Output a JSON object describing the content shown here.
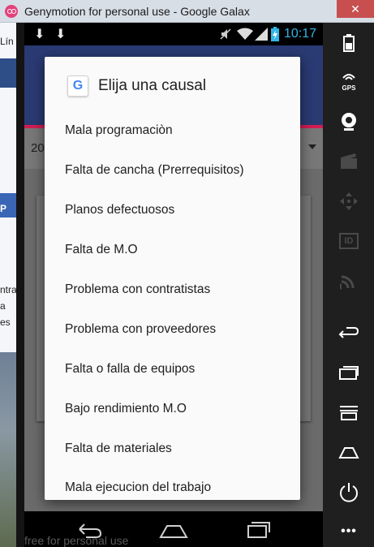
{
  "window": {
    "title": "Genymotion for personal use - Google Galax",
    "close_glyph": "✕"
  },
  "desktop": {
    "lines": [
      "Lín",
      "P",
      "ntra",
      "a",
      "es"
    ]
  },
  "statusbar": {
    "time": "10:17"
  },
  "app": {
    "spinner_value": "20"
  },
  "dialog": {
    "title": "Elija una causal",
    "logo_letter": "G",
    "items": [
      "Mala programaciòn",
      "Falta de cancha (Prerrequisitos)",
      "Planos defectuosos",
      "Falta de M.O",
      "Problema con contratistas",
      "Problema con proveedores",
      "Falta o falla de equipos",
      "Bajo rendimiento M.O",
      "Falta de materiales",
      "Mala ejecucion del trabajo"
    ]
  },
  "tools": {
    "gps_label": "GPS",
    "id_label": "ID",
    "more_glyph": "•••"
  },
  "watermark": "free for personal use"
}
